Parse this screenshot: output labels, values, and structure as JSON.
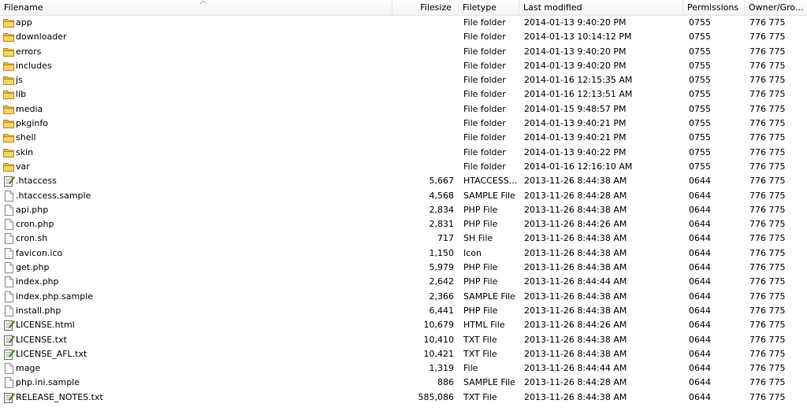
{
  "columns": {
    "filename": "Filename",
    "filesize": "Filesize",
    "filetype": "Filetype",
    "last_modified": "Last modified",
    "permissions": "Permissions",
    "owner": "Owner/Gro..."
  },
  "files": [
    {
      "icon": "folder-icon",
      "name": "app",
      "size": "",
      "type": "File folder",
      "modified": "2014-01-13 9:40:20 PM",
      "perm": "0755",
      "owner": "776 775"
    },
    {
      "icon": "folder-icon",
      "name": "downloader",
      "size": "",
      "type": "File folder",
      "modified": "2014-01-13 10:14:12 PM",
      "perm": "0755",
      "owner": "776 775"
    },
    {
      "icon": "folder-icon",
      "name": "errors",
      "size": "",
      "type": "File folder",
      "modified": "2014-01-13 9:40:20 PM",
      "perm": "0755",
      "owner": "776 775"
    },
    {
      "icon": "folder-icon",
      "name": "includes",
      "size": "",
      "type": "File folder",
      "modified": "2014-01-13 9:40:20 PM",
      "perm": "0755",
      "owner": "776 775"
    },
    {
      "icon": "folder-icon",
      "name": "js",
      "size": "",
      "type": "File folder",
      "modified": "2014-01-16 12:15:35 AM",
      "perm": "0755",
      "owner": "776 775"
    },
    {
      "icon": "folder-icon",
      "name": "lib",
      "size": "",
      "type": "File folder",
      "modified": "2014-01-16 12:13:51 AM",
      "perm": "0755",
      "owner": "776 775"
    },
    {
      "icon": "folder-icon",
      "name": "media",
      "size": "",
      "type": "File folder",
      "modified": "2014-01-15 9:48:57 PM",
      "perm": "0755",
      "owner": "776 775"
    },
    {
      "icon": "folder-icon",
      "name": "pkginfo",
      "size": "",
      "type": "File folder",
      "modified": "2014-01-13 9:40:21 PM",
      "perm": "0755",
      "owner": "776 775"
    },
    {
      "icon": "folder-icon",
      "name": "shell",
      "size": "",
      "type": "File folder",
      "modified": "2014-01-13 9:40:21 PM",
      "perm": "0755",
      "owner": "776 775"
    },
    {
      "icon": "folder-icon",
      "name": "skin",
      "size": "",
      "type": "File folder",
      "modified": "2014-01-13 9:40:22 PM",
      "perm": "0755",
      "owner": "776 775"
    },
    {
      "icon": "folder-icon",
      "name": "var",
      "size": "",
      "type": "File folder",
      "modified": "2014-01-16 12:16:10 AM",
      "perm": "0755",
      "owner": "776 775"
    },
    {
      "icon": "text-file-icon",
      "name": ".htaccess",
      "size": "5,667",
      "type": "HTACCESS...",
      "modified": "2013-11-26 8:44:38 AM",
      "perm": "0644",
      "owner": "776 775"
    },
    {
      "icon": "file-icon",
      "name": ".htaccess.sample",
      "size": "4,568",
      "type": "SAMPLE File",
      "modified": "2013-11-26 8:44:28 AM",
      "perm": "0644",
      "owner": "776 775"
    },
    {
      "icon": "file-icon",
      "name": "api.php",
      "size": "2,834",
      "type": "PHP File",
      "modified": "2013-11-26 8:44:38 AM",
      "perm": "0644",
      "owner": "776 775"
    },
    {
      "icon": "file-icon",
      "name": "cron.php",
      "size": "2,831",
      "type": "PHP File",
      "modified": "2013-11-26 8:44:26 AM",
      "perm": "0644",
      "owner": "776 775"
    },
    {
      "icon": "file-icon",
      "name": "cron.sh",
      "size": "717",
      "type": "SH File",
      "modified": "2013-11-26 8:44:38 AM",
      "perm": "0644",
      "owner": "776 775"
    },
    {
      "icon": "file-icon",
      "name": "favicon.ico",
      "size": "1,150",
      "type": "Icon",
      "modified": "2013-11-26 8:44:38 AM",
      "perm": "0644",
      "owner": "776 775"
    },
    {
      "icon": "file-icon",
      "name": "get.php",
      "size": "5,979",
      "type": "PHP File",
      "modified": "2013-11-26 8:44:38 AM",
      "perm": "0644",
      "owner": "776 775"
    },
    {
      "icon": "file-icon",
      "name": "index.php",
      "size": "2,642",
      "type": "PHP File",
      "modified": "2013-11-26 8:44:44 AM",
      "perm": "0644",
      "owner": "776 775"
    },
    {
      "icon": "file-icon",
      "name": "index.php.sample",
      "size": "2,366",
      "type": "SAMPLE File",
      "modified": "2013-11-26 8:44:38 AM",
      "perm": "0644",
      "owner": "776 775"
    },
    {
      "icon": "file-icon",
      "name": "install.php",
      "size": "6,441",
      "type": "PHP File",
      "modified": "2013-11-26 8:44:38 AM",
      "perm": "0644",
      "owner": "776 775"
    },
    {
      "icon": "text-file-icon",
      "name": "LICENSE.html",
      "size": "10,679",
      "type": "HTML File",
      "modified": "2013-11-26 8:44:26 AM",
      "perm": "0644",
      "owner": "776 775"
    },
    {
      "icon": "text-file-icon",
      "name": "LICENSE.txt",
      "size": "10,410",
      "type": "TXT File",
      "modified": "2013-11-26 8:44:38 AM",
      "perm": "0644",
      "owner": "776 775"
    },
    {
      "icon": "text-file-icon",
      "name": "LICENSE_AFL.txt",
      "size": "10,421",
      "type": "TXT File",
      "modified": "2013-11-26 8:44:38 AM",
      "perm": "0644",
      "owner": "776 775"
    },
    {
      "icon": "file-icon",
      "name": "mage",
      "size": "1,319",
      "type": "File",
      "modified": "2013-11-26 8:44:44 AM",
      "perm": "0644",
      "owner": "776 775"
    },
    {
      "icon": "file-icon",
      "name": "php.ini.sample",
      "size": "886",
      "type": "SAMPLE File",
      "modified": "2013-11-26 8:44:28 AM",
      "perm": "0644",
      "owner": "776 775"
    },
    {
      "icon": "text-file-icon",
      "name": "RELEASE_NOTES.txt",
      "size": "585,086",
      "type": "TXT File",
      "modified": "2013-11-26 8:44:38 AM",
      "perm": "0644",
      "owner": "776 775"
    }
  ]
}
